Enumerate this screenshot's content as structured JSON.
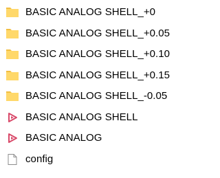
{
  "colors": {
    "folder_body": "#FFD86A",
    "folder_tab": "#F2BE42",
    "shortcut_arrow": "#D94A6A",
    "file_outline": "#8C8C8C"
  },
  "files": [
    {
      "name": "BASIC ANALOG SHELL_+0",
      "icon": "folder-icon"
    },
    {
      "name": "BASIC ANALOG SHELL_+0.05",
      "icon": "folder-icon"
    },
    {
      "name": "BASIC ANALOG SHELL_+0.10",
      "icon": "folder-icon"
    },
    {
      "name": "BASIC ANALOG SHELL_+0.15",
      "icon": "folder-icon"
    },
    {
      "name": "BASIC ANALOG SHELL_-0.05",
      "icon": "folder-icon"
    },
    {
      "name": "BASIC ANALOG SHELL",
      "icon": "app-icon"
    },
    {
      "name": "BASIC ANALOG",
      "icon": "app-icon"
    },
    {
      "name": "config",
      "icon": "file-icon"
    }
  ]
}
